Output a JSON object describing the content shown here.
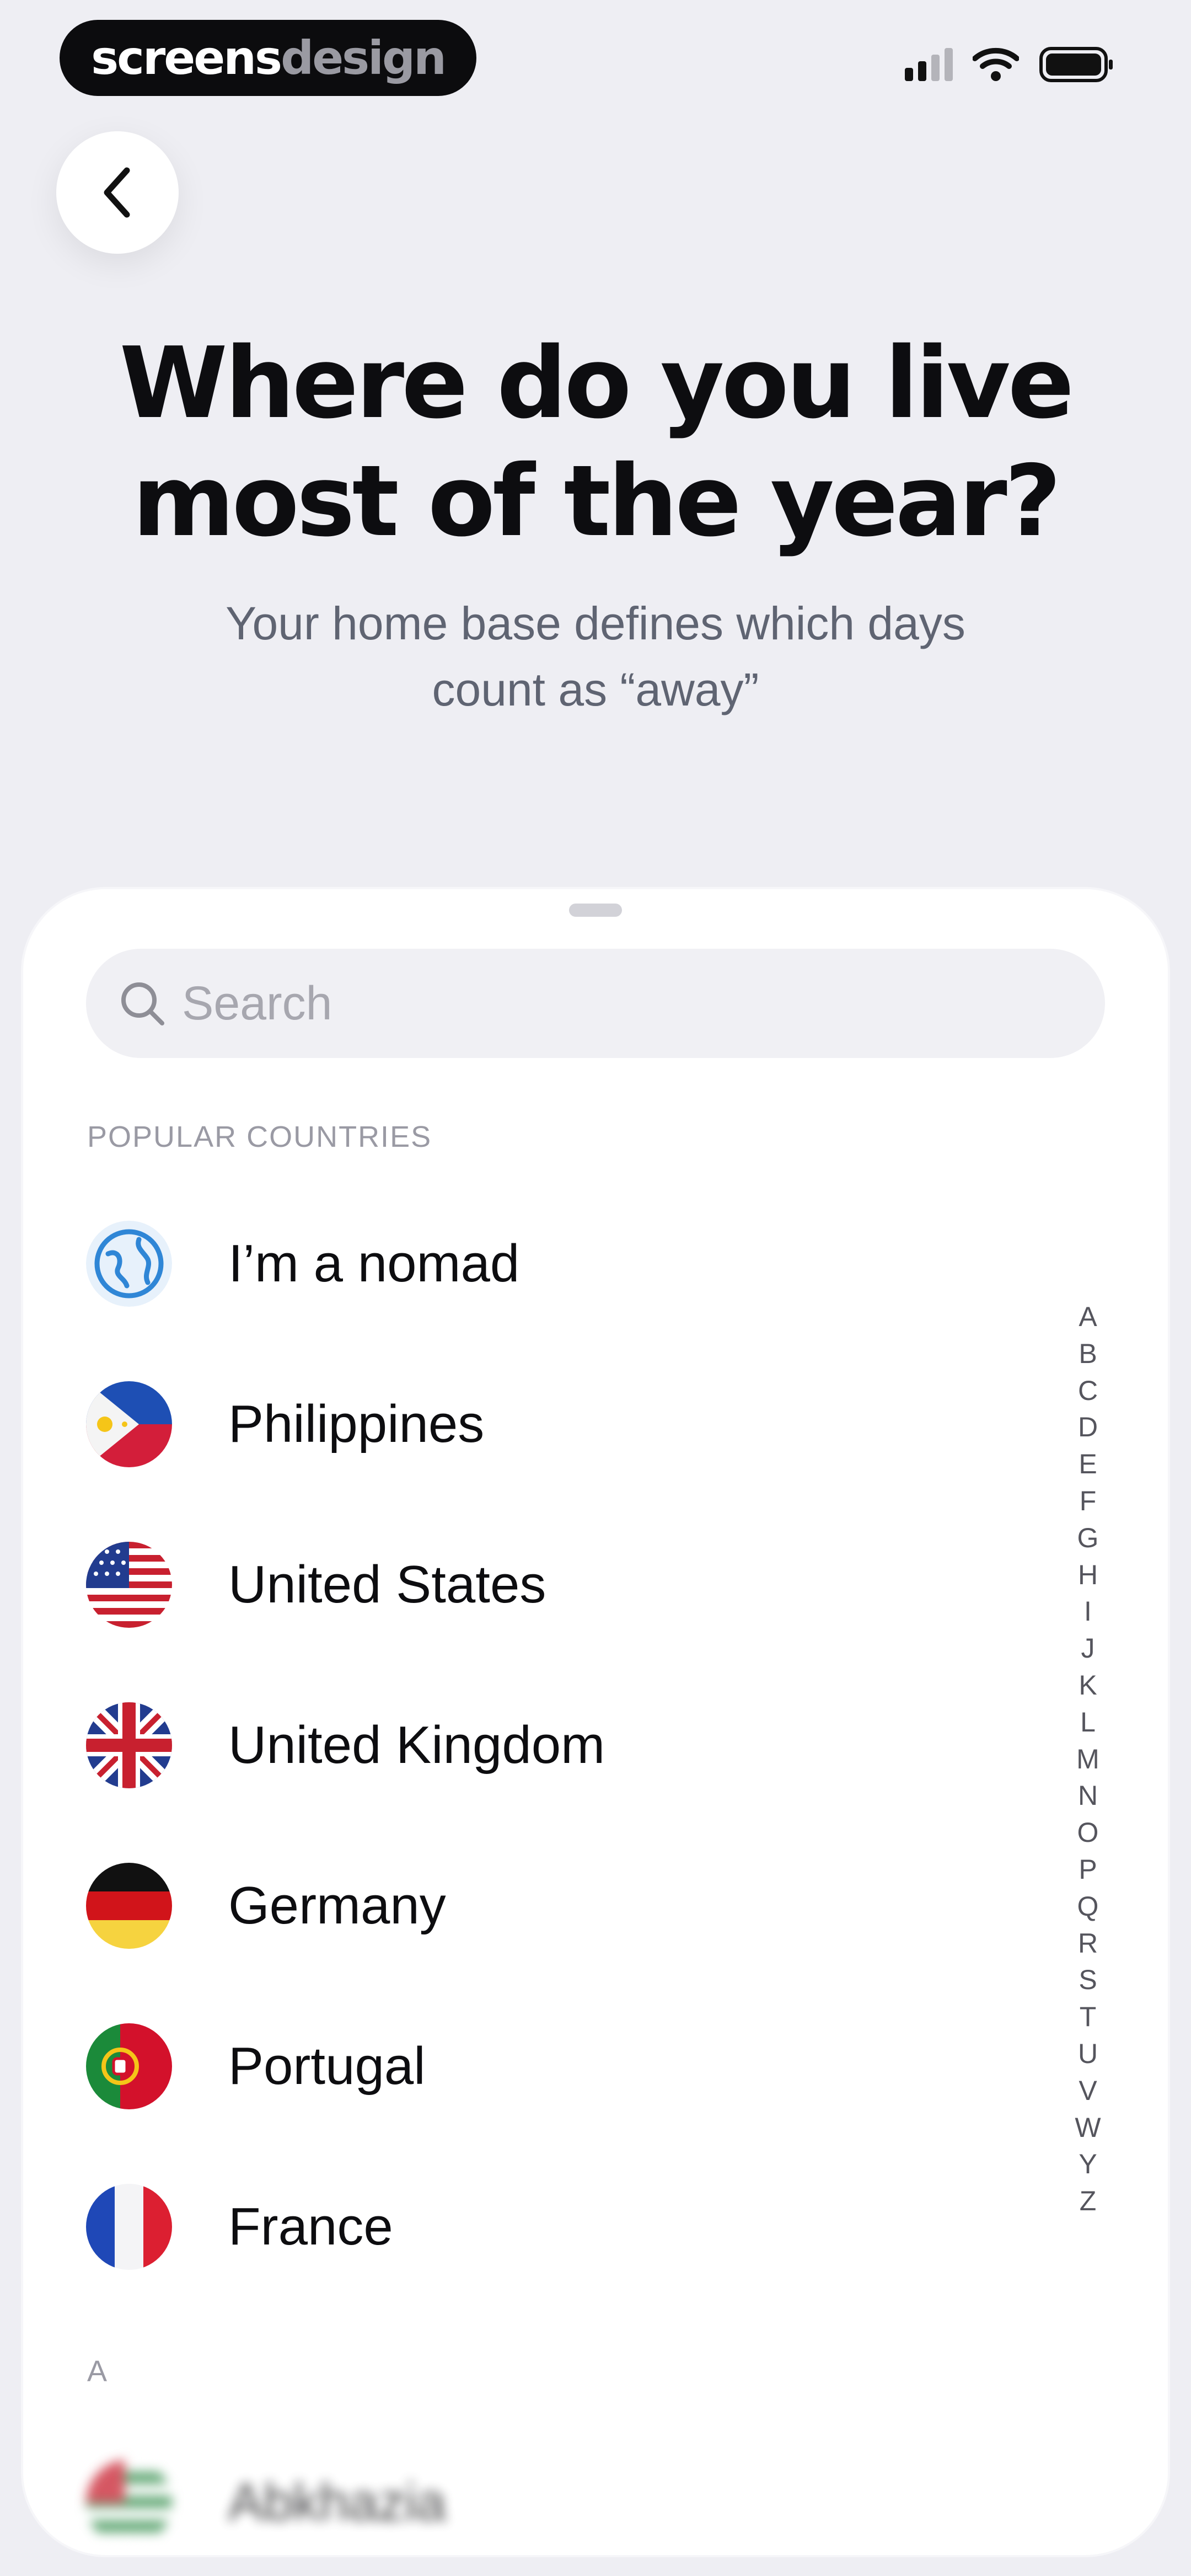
{
  "status_bar": {
    "brand_part_a": "screens",
    "brand_part_b": "design",
    "icons": [
      "signal-icon",
      "wifi-icon",
      "battery-icon"
    ]
  },
  "nav": {
    "back_icon": "chevron-left-icon"
  },
  "header": {
    "title_line1": "Where do you live",
    "title_line2": "most of the year?",
    "subtitle_line1": "Your home base defines which days",
    "subtitle_line2": "count as “away”"
  },
  "search": {
    "placeholder": "Search",
    "value": "",
    "icon": "search-icon"
  },
  "sections": {
    "popular_label": "POPULAR COUNTRIES",
    "a_label": "A"
  },
  "popular_countries": [
    {
      "label": "I’m a nomad",
      "icon": "globe-icon"
    },
    {
      "label": "Philippines",
      "icon": "flag-philippines"
    },
    {
      "label": "United States",
      "icon": "flag-united-states"
    },
    {
      "label": "United Kingdom",
      "icon": "flag-united-kingdom"
    },
    {
      "label": "Germany",
      "icon": "flag-germany"
    },
    {
      "label": "Portugal",
      "icon": "flag-portugal"
    },
    {
      "label": "France",
      "icon": "flag-france"
    }
  ],
  "a_countries": [
    {
      "label": "Abkhazia",
      "icon": "flag-abkhazia"
    }
  ],
  "alphabet_index": [
    "A",
    "B",
    "C",
    "D",
    "E",
    "F",
    "G",
    "H",
    "I",
    "J",
    "K",
    "L",
    "M",
    "N",
    "O",
    "P",
    "Q",
    "R",
    "S",
    "T",
    "U",
    "V",
    "W",
    "Y",
    "Z"
  ],
  "colors": {
    "background": "#eeeef3",
    "sheet": "#ffffff",
    "search_fill": "#f0f0f4",
    "title": "#0d0d10",
    "subtitle": "#5f6472",
    "muted": "#9a9aa4",
    "brand_pill": "#0c0c0e"
  }
}
